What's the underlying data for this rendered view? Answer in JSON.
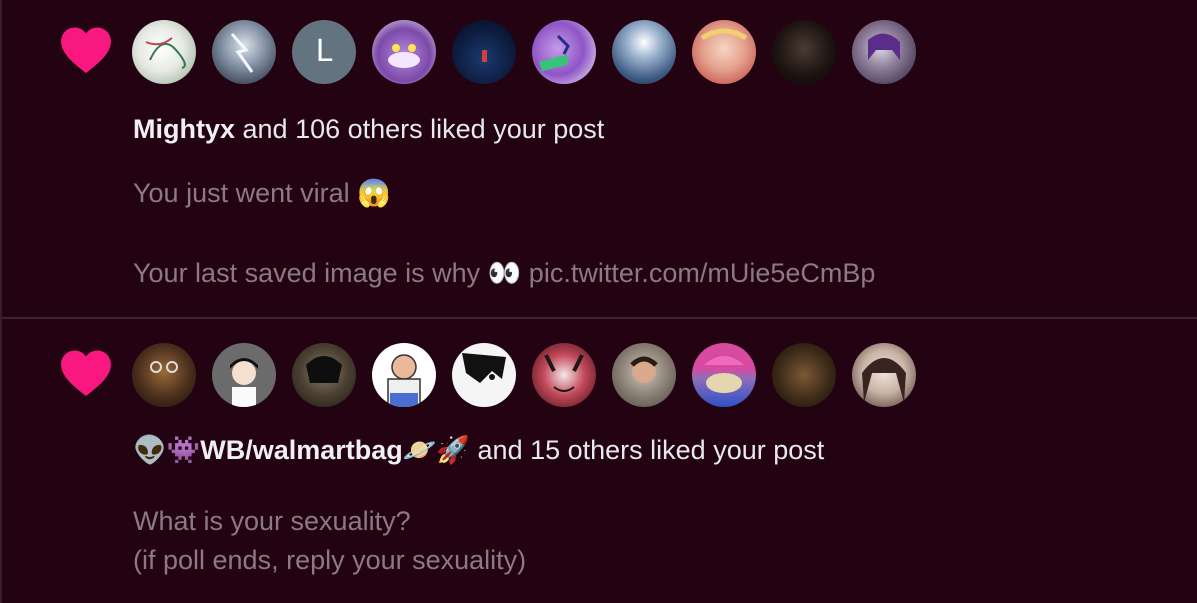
{
  "notifications": [
    {
      "actor": "Mightyx",
      "action_text": " and 106 others liked your post",
      "post_lines": [
        "You just went viral 😱",
        "Your last saved image is why 👀 pic.twitter.com/mUie5eCmBp"
      ],
      "avatars": [
        {
          "kind": "image",
          "desc": "sketch"
        },
        {
          "kind": "image",
          "desc": "storm"
        },
        {
          "kind": "letter",
          "letter": "L"
        },
        {
          "kind": "image",
          "desc": "cat"
        },
        {
          "kind": "image",
          "desc": "night"
        },
        {
          "kind": "image",
          "desc": "pony"
        },
        {
          "kind": "image",
          "desc": "light"
        },
        {
          "kind": "image",
          "desc": "character"
        },
        {
          "kind": "image",
          "desc": "dark"
        },
        {
          "kind": "image",
          "desc": "purple-hair"
        }
      ]
    },
    {
      "actor_prefix_emoji": "👽👾",
      "actor": "WB/walmartbag",
      "actor_suffix_emoji": "🪐🚀",
      "action_text": " and 15 others liked your post",
      "post_lines": [
        "What is your sexuality?",
        "(if poll ends, reply your sexuality)"
      ],
      "avatars": [
        {
          "kind": "image",
          "desc": "glasses"
        },
        {
          "kind": "image",
          "desc": "cartoon-boy"
        },
        {
          "kind": "image",
          "desc": "soldier"
        },
        {
          "kind": "image",
          "desc": "bald-man"
        },
        {
          "kind": "image",
          "desc": "manga"
        },
        {
          "kind": "image",
          "desc": "demon"
        },
        {
          "kind": "image",
          "desc": "boy-photo"
        },
        {
          "kind": "image",
          "desc": "pink-hat"
        },
        {
          "kind": "image",
          "desc": "man-portrait"
        },
        {
          "kind": "image",
          "desc": "anime-girl"
        }
      ]
    }
  ],
  "colors": {
    "background": "#230212",
    "heart": "#f91880",
    "muted_text": "#8b7a82"
  }
}
